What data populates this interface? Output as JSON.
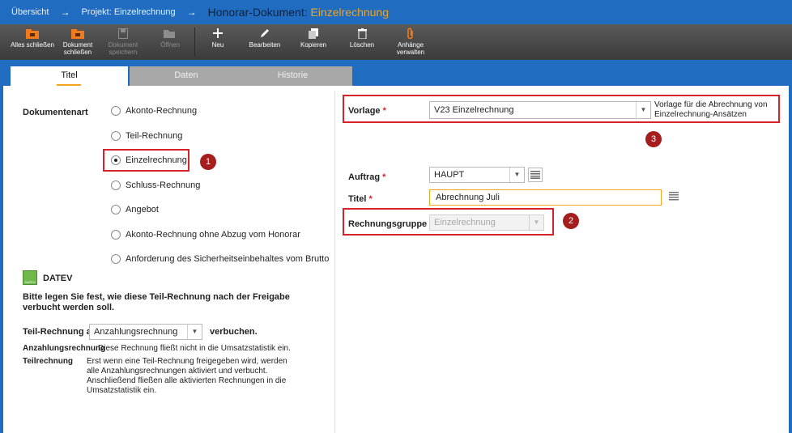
{
  "breadcrumb": {
    "overview": "Übersicht",
    "arrow": "→",
    "project": "Projekt: Einzelrechnung",
    "doc_prefix": "Honorar-Dokument:",
    "doc_name": "Einzelrechnung"
  },
  "toolbar": {
    "close_all": "Alles schließen",
    "close_doc": "Dokument schließen",
    "save_doc": "Dokument speichern",
    "open": "Öffnen",
    "new": "Neu",
    "edit": "Bearbeiten",
    "copy": "Kopieren",
    "delete": "Löschen",
    "attachments": "Anhänge verwalten"
  },
  "tabs": {
    "title": "Titel",
    "data": "Daten",
    "history": "Historie"
  },
  "left": {
    "doctype_label": "Dokumentenart",
    "options": [
      "Akonto-Rechnung",
      "Teil-Rechnung",
      "Einzelrechnung",
      "Schluss-Rechnung",
      "Angebot",
      "Akonto-Rechnung ohne Abzug vom Honorar",
      "Anforderung des Sicherheitseinbehaltes vom Brutto"
    ],
    "selected_option": "Einzelrechnung",
    "datev_label": "DATEV",
    "datev_logo": "DATEV",
    "datev_hint": "Bitte legen Sie fest, wie diese Teil-Rechnung nach der Freigabe verbucht werden soll.",
    "partial_as_label": "Teil-Rechnung als",
    "partial_as_value": "Anzahlungsrechnung",
    "post_label": "verbuchen.",
    "def1_term": "Anzahlungsrechnung",
    "def1_text": "Diese Rechnung fließt nicht in die Umsatzstatistik ein.",
    "def2_term": "Teilrechnung",
    "def2_text": "Erst wenn eine Teil-Rechnung freigegeben wird, werden alle Anzahlungsrechnungen aktiviert und verbucht. Anschließend fließen alle aktivierten Rechnungen in die Umsatzstatistik ein."
  },
  "right": {
    "template_label": "Vorlage",
    "template_value": "V23 Einzelrechnung",
    "template_hint": "Vorlage für die Abrechnung von Einzelrechnung-Ansätzen",
    "order_label": "Auftrag",
    "order_value": "HAUPT",
    "title_label": "Titel",
    "title_value": "Abrechnung Juli",
    "group_label": "Rechnungsgruppe",
    "group_value": "Einzelrechnung",
    "required_mark": "*"
  },
  "badges": {
    "one": "1",
    "two": "2",
    "three": "3"
  },
  "colors": {
    "header_blue": "#1f6cc0",
    "accent_orange": "#f3a31e",
    "annotation_red": "#d8222a",
    "badge_red": "#a51d1d"
  }
}
